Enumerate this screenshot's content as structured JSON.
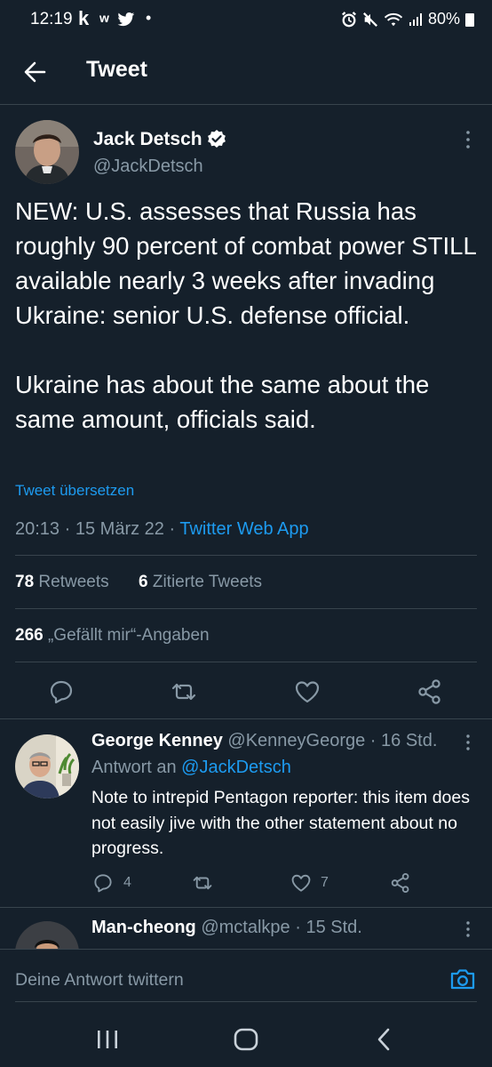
{
  "status_bar": {
    "time": "12:19",
    "notif_k": "k",
    "notif_w": "w",
    "battery": "80%"
  },
  "header": {
    "title": "Tweet"
  },
  "tweet": {
    "author_name": "Jack Detsch",
    "author_handle": "@JackDetsch",
    "text": "NEW: U.S. assesses that Russia has roughly 90 percent of combat power STILL available nearly 3 weeks after invading Ukraine: senior U.S. defense official.\n\nUkraine has about the same about the same amount, officials said.",
    "translate_label": "Tweet übersetzen",
    "time": "20:13",
    "sep1": "·",
    "date": "15 März 22",
    "sep2": "·",
    "source": "Twitter Web App",
    "retweets_count": "78",
    "retweets_label": "Retweets",
    "quotes_count": "6",
    "quotes_label": "Zitierte Tweets",
    "likes_count": "266",
    "likes_label": "„Gefällt mir“-Angaben"
  },
  "replies": [
    {
      "name": "George Kenney",
      "handle": "@KenneyGeorge",
      "time": "· 16 Std.",
      "reply_to_label": "Antwort an",
      "reply_to_handle": "@JackDetsch",
      "text": "Note to intrepid Pentagon reporter: this item does not easily jive with the other statement about no progress.",
      "reply_count": "4",
      "like_count": "7"
    },
    {
      "name": "Man-cheong",
      "handle": "@mctalkpe",
      "time": "· 15 Std."
    }
  ],
  "compose": {
    "placeholder": "Deine Antwort twittern"
  },
  "colors": {
    "background": "#15202b",
    "accent": "#1d9bf0",
    "muted": "#8899a6",
    "divider": "#38444d"
  },
  "icons": [
    "back-arrow-icon",
    "verified-badge-icon",
    "more-options-icon",
    "reply-icon",
    "retweet-icon",
    "like-icon",
    "share-icon",
    "camera-icon",
    "recents-icon",
    "home-icon",
    "nav-back-icon"
  ]
}
